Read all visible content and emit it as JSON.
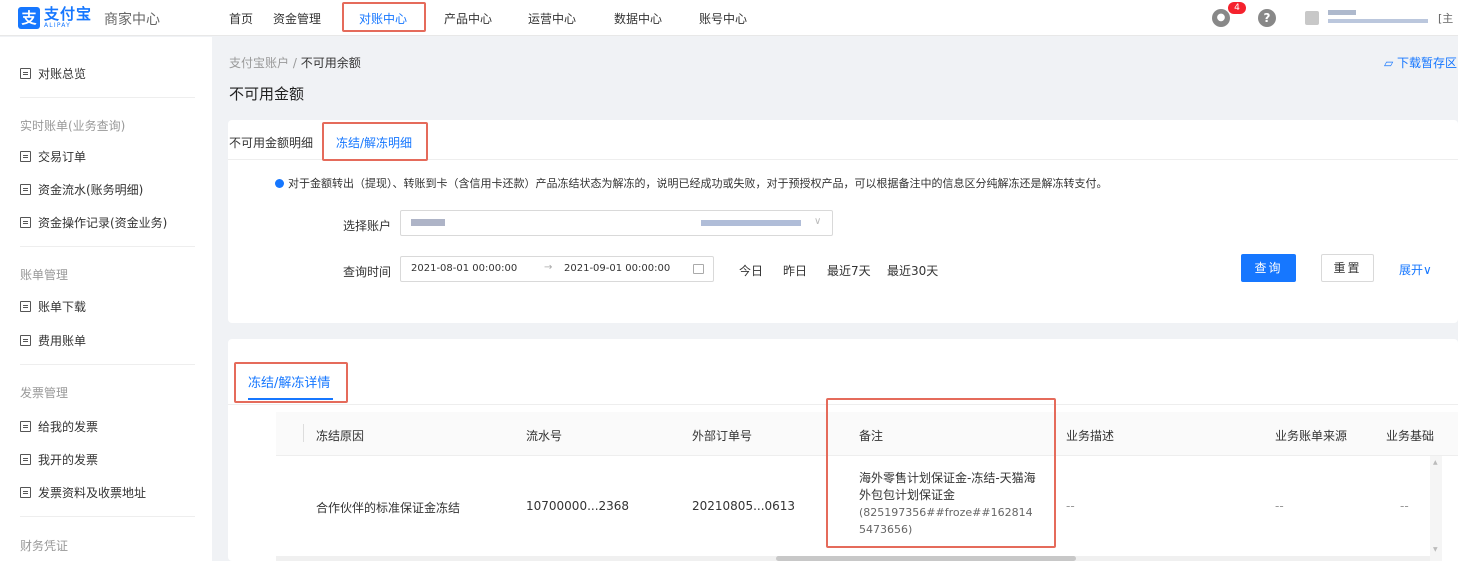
{
  "header": {
    "logo_mark": "支",
    "logo_cn": "支付宝",
    "logo_en": "ALIPAY",
    "subtitle": "商家中心",
    "nav": [
      {
        "label": "首页"
      },
      {
        "label": "资金管理"
      },
      {
        "label": "对账中心"
      },
      {
        "label": "产品中心"
      },
      {
        "label": "运营中心"
      },
      {
        "label": "数据中心"
      },
      {
        "label": "账号中心"
      }
    ],
    "active_nav": "对账中心",
    "notification_count": "4",
    "help_glyph": "?",
    "user_role": "[主"
  },
  "sidebar": {
    "items": [
      {
        "label": "对账总览"
      },
      {
        "group": "实时账单(业务查询)"
      },
      {
        "label": "交易订单"
      },
      {
        "label": "资金流水(账务明细)"
      },
      {
        "label": "资金操作记录(资金业务)"
      },
      {
        "group": "账单管理"
      },
      {
        "label": "账单下载"
      },
      {
        "label": "费用账单"
      },
      {
        "group": "发票管理"
      },
      {
        "label": "给我的发票"
      },
      {
        "label": "我开的发票"
      },
      {
        "label": "发票资料及收票地址"
      },
      {
        "group": "财务凭证"
      }
    ]
  },
  "breadcrumb": {
    "parent": "支付宝账户",
    "separator": "/",
    "current": "不可用余额"
  },
  "page_title": "不可用金额",
  "download_link": "下载暂存区",
  "tabs": [
    {
      "label": "不可用金额明细"
    },
    {
      "label": "冻结/解冻明细"
    }
  ],
  "notice": "对于金额转出（提现）、转账到卡（含信用卡还款）产品冻结状态为解冻的，说明已经成功或失败，对于预授权产品，可以根据备注中的信息区分纯解冻还是解冻转支付。",
  "filters": {
    "account_label": "选择账户",
    "time_label": "查询时间",
    "date_start": "2021-08-01 00:00:00",
    "date_arrow": "→",
    "date_end": "2021-09-01 00:00:00",
    "quick": [
      "今日",
      "昨日",
      "最近7天",
      "最近30天"
    ],
    "query_button": "查询",
    "reset_button": "重置",
    "expand_link": "展开∨"
  },
  "section_title": "冻结/解冻详情",
  "table": {
    "columns": [
      "冻结原因",
      "流水号",
      "外部订单号",
      "备注",
      "业务描述",
      "业务账单来源",
      "业务基础"
    ],
    "rows": [
      {
        "reason": "合作伙伴的标准保证金冻结",
        "serial": "10700000...2368",
        "order": "20210805...0613",
        "note_main": "海外零售计划保证金-冻结-天猫海外包包计划保证金",
        "note_sub": "(825197356##froze##1628145473656)",
        "desc": "--",
        "source": "--",
        "base": "--"
      }
    ]
  },
  "colors": {
    "accent": "#1677ff",
    "highlight_box": "#e56b5b",
    "badge": "#f5222d"
  }
}
